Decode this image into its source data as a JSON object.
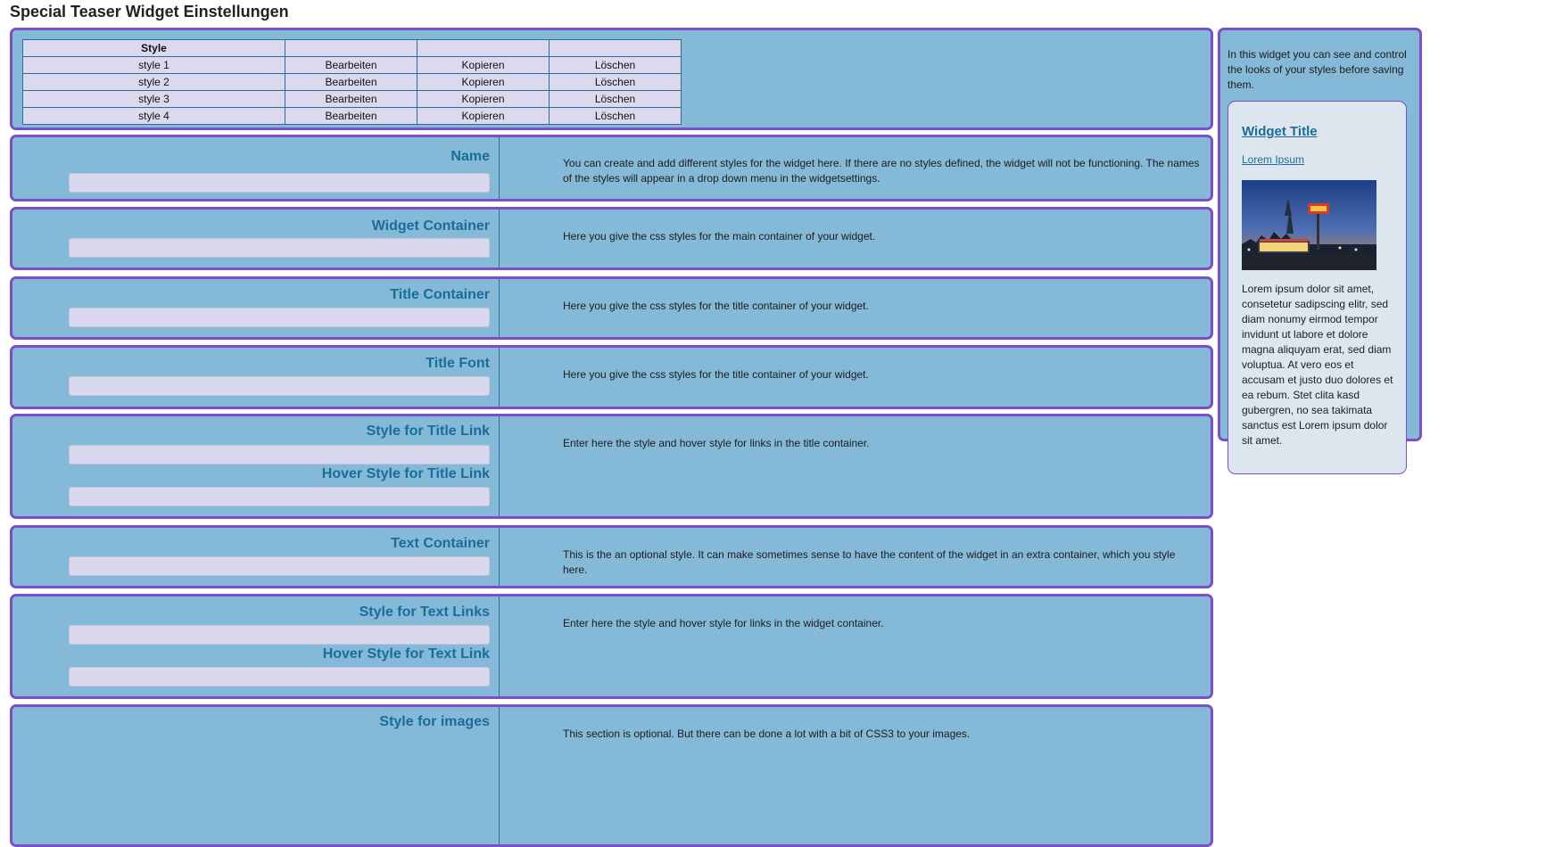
{
  "page": {
    "title": "Special Teaser Widget Einstellungen"
  },
  "styles_table": {
    "header": "Style",
    "rows": [
      {
        "name": "style 1",
        "edit": "Bearbeiten",
        "copy": "Kopieren",
        "delete": "Löschen"
      },
      {
        "name": "style 2",
        "edit": "Bearbeiten",
        "copy": "Kopieren",
        "delete": "Löschen"
      },
      {
        "name": "style 3",
        "edit": "Bearbeiten",
        "copy": "Kopieren",
        "delete": "Löschen"
      },
      {
        "name": "style 4",
        "edit": "Bearbeiten",
        "copy": "Kopieren",
        "delete": "Löschen"
      }
    ]
  },
  "sections": {
    "name": {
      "label": "Name",
      "value": "",
      "desc": "You can create and add different styles for the widget here. If there are no styles defined, the widget will not be functioning. The names of the styles will appear in a drop down menu in the widgetsettings."
    },
    "widget_container": {
      "label": "Widget Container",
      "value": "",
      "desc": "Here you give the css styles for the main container of your widget."
    },
    "title_container": {
      "label": "Title Container",
      "value": "",
      "desc": "Here you give the css styles for the title container of your widget."
    },
    "title_font": {
      "label": "Title Font",
      "value": "",
      "desc": "Here you give the css styles for the title container of your widget."
    },
    "title_link": {
      "label": "Style for Title Link",
      "value": "",
      "hover_label": "Hover Style for Title Link",
      "hover_value": "",
      "desc": "Enter here the style and hover style for links in the title container."
    },
    "text_container": {
      "label": "Text Container",
      "value": "",
      "desc": "This is the an optional style. It can make sometimes sense to have the content of the widget in an extra container, which you style here."
    },
    "text_links": {
      "label": "Style for Text Links",
      "value": "",
      "hover_label": "Hover Style for Text Link",
      "hover_value": "",
      "desc": "Enter here the style and hover style for links in the widget container."
    },
    "images": {
      "label": "Style for images",
      "desc": "This section is optional. But there can be done a lot with a bit of CSS3 to your images."
    }
  },
  "sidebar": {
    "intro": "In this widget you can see and control the looks of your styles before saving them.",
    "preview": {
      "title": "Widget Title",
      "link": "Lorem Ipsum",
      "image_icon": "storefront-photo-icon",
      "text": "Lorem ipsum dolor sit amet, consetetur sadipscing elitr, sed diam nonumy eirmod tempor invidunt ut labore et dolore magna aliquyam erat, sed diam voluptua. At vero eos et accusam et justo duo dolores et ea rebum. Stet clita kasd gubergren, no sea takimata sanctus est Lorem ipsum dolor sit amet."
    }
  },
  "colors": {
    "panel_bg": "#85b9d8",
    "panel_border": "#7c4fc6",
    "label_color": "#1a6c99",
    "input_bg": "#dad8ee"
  }
}
